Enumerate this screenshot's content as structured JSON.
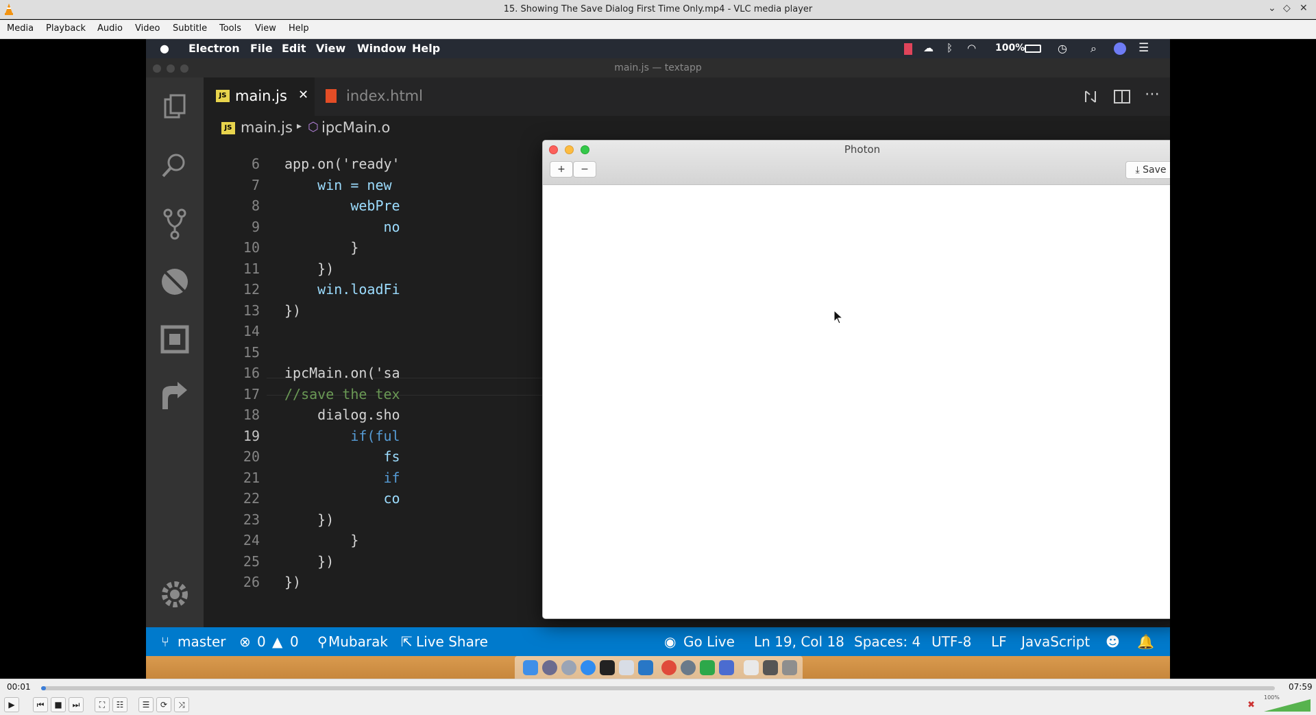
{
  "window": {
    "title": "15. Showing The Save Dialog First Time Only.mp4 - VLC media player",
    "controls": [
      "⌄",
      "◇",
      "✕"
    ]
  },
  "menubar": [
    "Media",
    "Playback",
    "Audio",
    "Video",
    "Subtitle",
    "Tools",
    "View",
    "Help"
  ],
  "mac_menubar": {
    "app": "Electron",
    "items": [
      "File",
      "Edit",
      "View",
      "Window",
      "Help"
    ],
    "battery": "100%"
  },
  "vscode": {
    "window_title": "main.js — textapp",
    "tabs": [
      {
        "label": "main.js",
        "close": "✕",
        "active": true
      },
      {
        "label": "index.html",
        "active": false
      }
    ],
    "breadcrumb": {
      "file": "main.js",
      "separator": "▸",
      "symbol": "ipcMain.o"
    },
    "lines": [
      {
        "n": "6",
        "code": "app.on('ready'"
      },
      {
        "n": "7",
        "code": "    win = new"
      },
      {
        "n": "8",
        "code": "        webPre"
      },
      {
        "n": "9",
        "code": "            no"
      },
      {
        "n": "10",
        "code": "        }"
      },
      {
        "n": "11",
        "code": "    })"
      },
      {
        "n": "12",
        "code": "    win.loadFi"
      },
      {
        "n": "13",
        "code": "})"
      },
      {
        "n": "14",
        "code": ""
      },
      {
        "n": "15",
        "code": ""
      },
      {
        "n": "16",
        "code": "ipcMain.on('sa"
      },
      {
        "n": "17",
        "code": "//save the tex"
      },
      {
        "n": "18",
        "code": "    dialog.sho"
      },
      {
        "n": "19",
        "code": "        if(ful"
      },
      {
        "n": "20",
        "code": "            fs"
      },
      {
        "n": "21",
        "code": "            if"
      },
      {
        "n": "22",
        "code": "            co"
      },
      {
        "n": "23",
        "code": "    })"
      },
      {
        "n": "24",
        "code": "        }"
      },
      {
        "n": "25",
        "code": "    })"
      },
      {
        "n": "26",
        "code": "})"
      }
    ],
    "status": {
      "branch": "master",
      "errors": "0",
      "warnings": "0",
      "user": "Mubarak",
      "live_share": "Live Share",
      "go_live": "Go Live",
      "position": "Ln 19, Col 18",
      "spaces": "Spaces: 4",
      "encoding": "UTF-8",
      "eol": "LF",
      "language": "JavaScript"
    }
  },
  "photon": {
    "title": "Photon",
    "add": "+",
    "remove": "−",
    "save": "Save"
  },
  "player": {
    "elapsed": "00:01",
    "total": "07:59",
    "progress": 0.002,
    "volume_label": "100%",
    "volume": 1.0
  },
  "colors": {
    "vscode_status": "#007acc",
    "keyword": "#569cd6",
    "string": "#ce9178",
    "comment": "#6a9955",
    "fn": "#dcdcaa",
    "var": "#9cdcfe"
  }
}
